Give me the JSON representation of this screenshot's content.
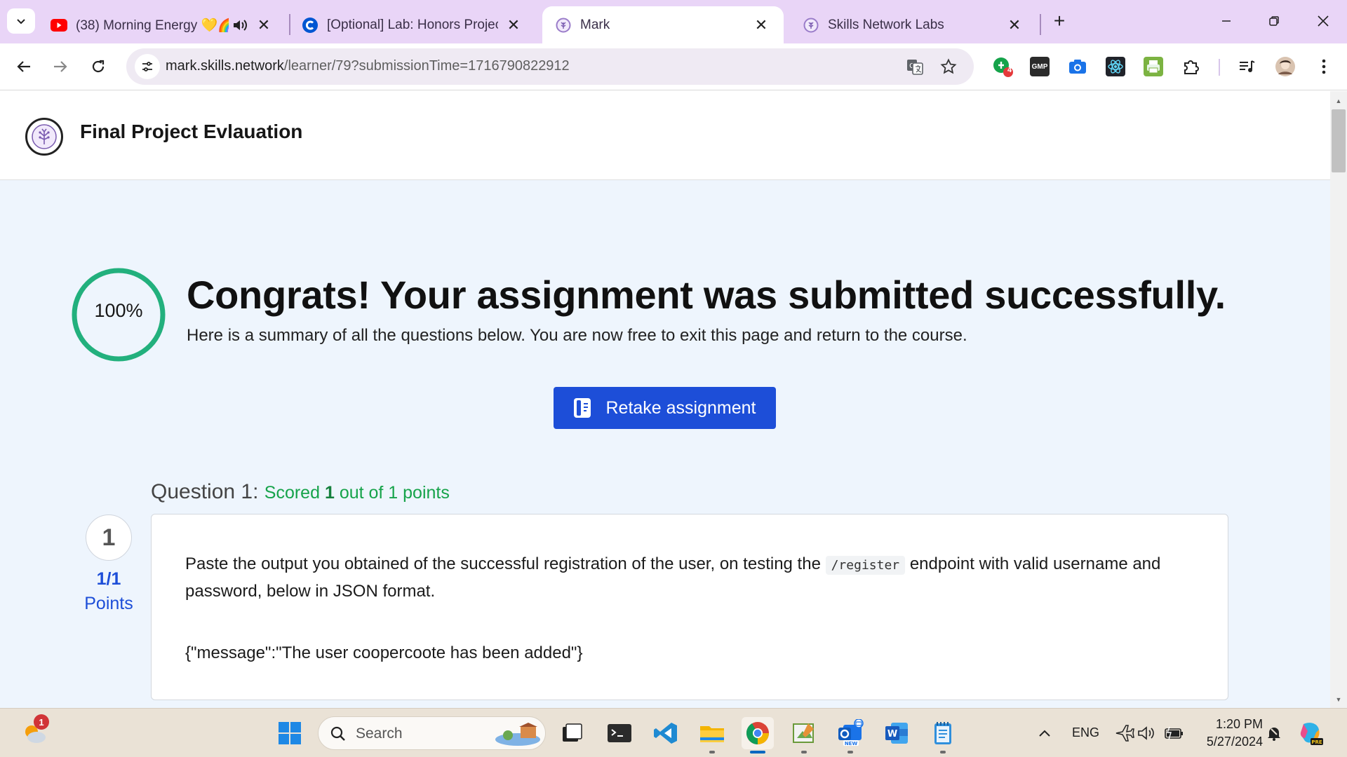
{
  "browser": {
    "tabs": [
      {
        "title": "(38) Morning Energy 💛🌈",
        "favicon": "youtube-icon",
        "audio": true,
        "active": false
      },
      {
        "title": "[Optional] Lab: Honors Project |",
        "favicon": "coursera-icon",
        "active": false
      },
      {
        "title": "Mark",
        "favicon": "skills-network-icon",
        "active": true
      },
      {
        "title": "Skills Network Labs",
        "favicon": "skills-network-icon",
        "active": false
      }
    ],
    "url_host": "mark.skills.network",
    "url_path": "/learner/79?submissionTime=1716790822912",
    "extensions": [
      "grammarly-icon",
      "gmp-icon",
      "camera-icon",
      "react-devtools-icon",
      "printer-icon",
      "extensions-puzzle-icon",
      "media-control-icon",
      "profile-avatar"
    ],
    "grammarly_badge": "4",
    "gmp_label": "GMP"
  },
  "page": {
    "app_title": "Final Project Evlauation",
    "progress_percent": 100,
    "progress_label": "100%",
    "congrats_title": "Congrats! Your assignment was submitted successfully.",
    "summary_text": "Here is a summary of all the questions below. You are now free to exit this page and return to the course.",
    "retake_label": "Retake assignment",
    "accent_color": "#1d4ed8",
    "success_color": "#16a34a",
    "questions": [
      {
        "heading_prefix": "Question 1:",
        "score_prefix": "Scored",
        "score_value": "1",
        "score_suffix": "out of 1 points",
        "number": "1",
        "points_fraction": "1/1",
        "points_label": "Points",
        "text_before": "Paste the output you obtained of the successful registration of the user, on testing the",
        "code": "/register",
        "text_after": "endpoint with valid username and password,  below in JSON format.",
        "answer": "{\"message\":\"The user coopercoote has been added\"}"
      }
    ]
  },
  "taskbar": {
    "notification_badge": "1",
    "search_placeholder": "Search",
    "apps": [
      "start-icon",
      "task-view-icon",
      "terminal-icon",
      "vscode-icon",
      "file-explorer-icon",
      "chrome-icon",
      "paint-icon",
      "outlook-new-icon",
      "word-icon",
      "notepad-icon"
    ],
    "language": "ENG",
    "time": "1:20 PM",
    "date": "5/27/2024"
  }
}
